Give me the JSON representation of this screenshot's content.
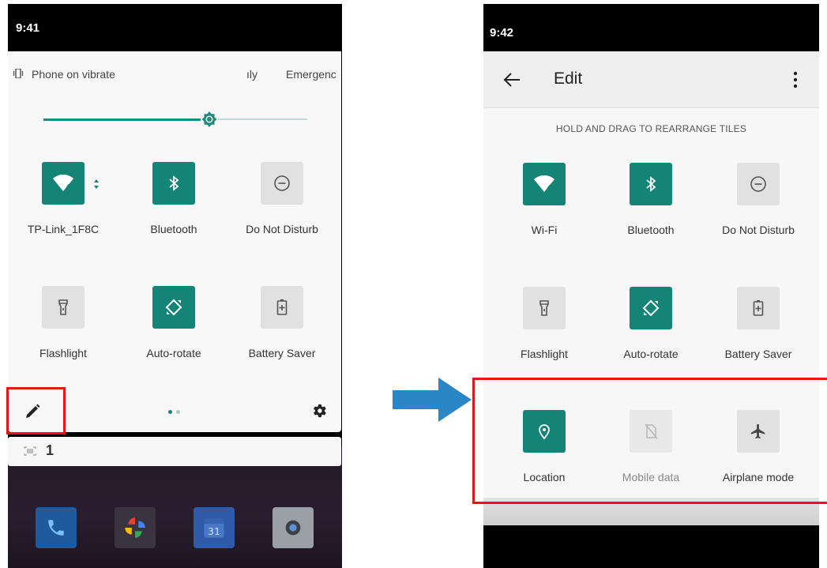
{
  "colors": {
    "accent": "#138476",
    "tile_off": "#e1e1e1",
    "highlight": "#e01818",
    "arrow": "#2a86c4"
  },
  "left_phone": {
    "status_time": "9:41",
    "ringer": {
      "icon": "vibrate-icon",
      "label": "Phone on vibrate"
    },
    "top_tabs": {
      "only": "ıly",
      "emergency": "Emergency"
    },
    "brightness": {
      "level": 0.63
    },
    "tiles": [
      {
        "label": "TP-Link_1F8C",
        "icon": "wifi-icon",
        "state": "on"
      },
      {
        "label": "Bluetooth",
        "icon": "bluetooth-icon",
        "state": "on"
      },
      {
        "label": "Do Not Disturb",
        "icon": "do-not-disturb-icon",
        "state": "off"
      },
      {
        "label": "Flashlight",
        "icon": "flashlight-icon",
        "state": "off"
      },
      {
        "label": "Auto-rotate",
        "icon": "auto-rotate-icon",
        "state": "on"
      },
      {
        "label": "Battery Saver",
        "icon": "battery-saver-icon",
        "state": "off"
      }
    ],
    "notification": {
      "count": "1"
    }
  },
  "right_phone": {
    "status_time": "9:42",
    "header": {
      "title": "Edit"
    },
    "hint": "HOLD AND DRAG TO REARRANGE TILES",
    "tiles": [
      {
        "label": "Wi-Fi",
        "icon": "wifi-icon",
        "state": "on"
      },
      {
        "label": "Bluetooth",
        "icon": "bluetooth-icon",
        "state": "on"
      },
      {
        "label": "Do Not Disturb",
        "icon": "do-not-disturb-icon",
        "state": "off"
      },
      {
        "label": "Flashlight",
        "icon": "flashlight-icon",
        "state": "off"
      },
      {
        "label": "Auto-rotate",
        "icon": "auto-rotate-icon",
        "state": "on"
      },
      {
        "label": "Battery Saver",
        "icon": "battery-saver-icon",
        "state": "off"
      },
      {
        "label": "Location",
        "icon": "location-icon",
        "state": "on"
      },
      {
        "label": "Mobile data",
        "icon": "mobile-data-icon",
        "state": "unavailable"
      },
      {
        "label": "Airplane mode",
        "icon": "airplane-icon",
        "state": "off"
      }
    ]
  }
}
